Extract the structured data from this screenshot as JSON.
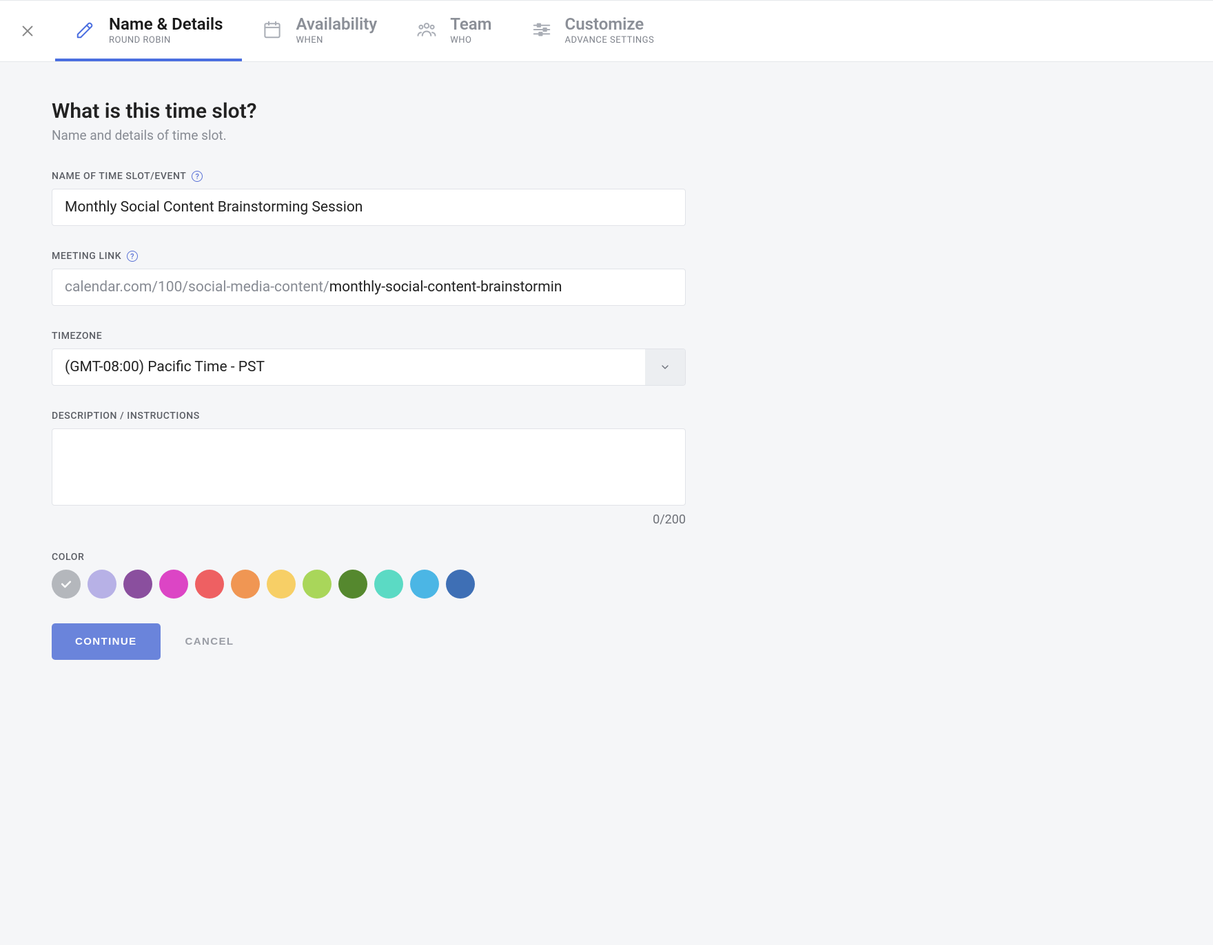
{
  "tabs": [
    {
      "title": "Name & Details",
      "subtitle": "ROUND ROBIN",
      "active": true
    },
    {
      "title": "Availability",
      "subtitle": "WHEN",
      "active": false
    },
    {
      "title": "Team",
      "subtitle": "WHO",
      "active": false
    },
    {
      "title": "Customize",
      "subtitle": "ADVANCE SETTINGS",
      "active": false
    }
  ],
  "page": {
    "title": "What is this time slot?",
    "subtitle": "Name and details of time slot."
  },
  "fields": {
    "name": {
      "label": "NAME OF TIME SLOT/EVENT",
      "value": "Monthly Social Content Brainstorming Session"
    },
    "meeting_link": {
      "label": "MEETING LINK",
      "prefix": "calendar.com/100/social-media-content/",
      "slug": "monthly-social-content-brainstormin"
    },
    "timezone": {
      "label": "TIMEZONE",
      "value": "(GMT-08:00) Pacific Time - PST"
    },
    "description": {
      "label": "DESCRIPTION / INSTRUCTIONS",
      "value": "",
      "char_count": "0/200"
    },
    "color": {
      "label": "COLOR",
      "selected_index": 0,
      "options": [
        "#b4b7bc",
        "#b7b1e6",
        "#8a4f9e",
        "#dc45c5",
        "#ee6062",
        "#f09653",
        "#f7cf66",
        "#a9d65a",
        "#55882e",
        "#5bdac4",
        "#4bb6e5",
        "#3e6fb5"
      ]
    }
  },
  "actions": {
    "continue": "CONTINUE",
    "cancel": "CANCEL"
  }
}
